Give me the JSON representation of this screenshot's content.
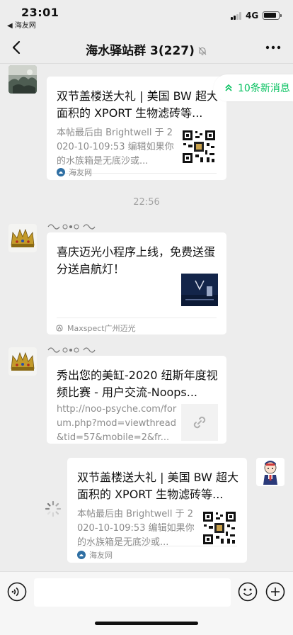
{
  "status_bar": {
    "time": "23:01",
    "back_app": "◀ 海友网",
    "network": "4G"
  },
  "nav": {
    "title": "海水驿站群 3(227)"
  },
  "new_messages_pill": {
    "label": "10条新消息"
  },
  "timestamp": "22:56",
  "messages": [
    {
      "title": "双节盖楼送大礼 | 美国 BW 超大面积的 XPORT 生物滤砖等...",
      "description": "本帖最后由 Brightwell 于 2020-10-109:53 编辑如果你的水族箱是无底沙或...",
      "source": "海友网",
      "source_icon": "site-logo-icon",
      "thumbnail": "qr-code-icon"
    },
    {
      "title": "喜庆迈光小程序上线，免费送蛋分送启航灯！",
      "description": "",
      "source": "Maxspect广州迈光",
      "source_icon": "mini-program-icon",
      "thumbnail": "product-thumbnail"
    },
    {
      "title": "秀出您的美缸-2020 纽斯年度视频比赛 - 用户交流-Noops...",
      "description": "http://noo-psyche.com/forum.php?mod=viewthread&tid=57&mobile=2&fr...",
      "source": "",
      "thumbnail": "link-icon"
    },
    {
      "title": "双节盖楼送大礼 | 美国 BW 超大面积的 XPORT 生物滤砖等...",
      "description": "本帖最后由 Brightwell 于 2020-10-109:53 编辑如果你的水族箱是无底沙或...",
      "source": "海友网",
      "source_icon": "site-logo-icon",
      "thumbnail": "qr-code-icon"
    }
  ],
  "colors": {
    "background": "#ededed",
    "accent_green": "#07c160",
    "bubble": "#ffffff"
  }
}
